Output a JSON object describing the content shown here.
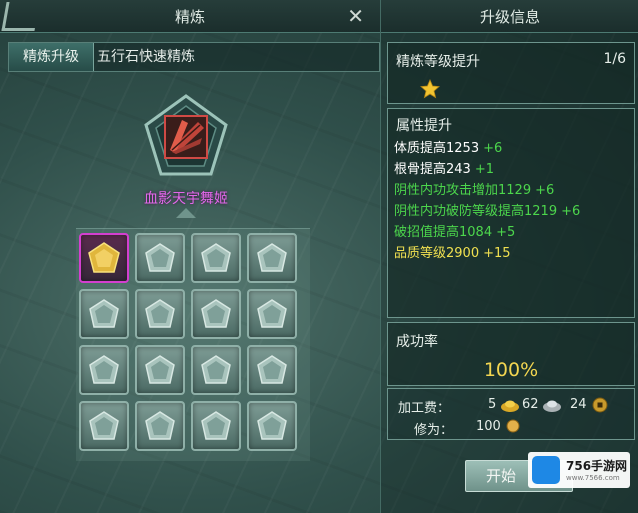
{
  "left_panel": {
    "title": "精炼",
    "tabs": [
      {
        "label": "精炼升级"
      },
      {
        "label": "五行石快速精炼"
      }
    ],
    "item_name": "血影天宇舞姬",
    "slots": 16
  },
  "right_panel": {
    "title": "升级信息",
    "level_up": {
      "label": "精炼等级提升",
      "count": "1/6"
    },
    "attributes": {
      "label": "属性提升",
      "rows": [
        {
          "text": "体质提高1253",
          "plus": "+6",
          "color": "#ffffff",
          "plus_color": "#4cd64c"
        },
        {
          "text": "根骨提高243",
          "plus": "+1",
          "color": "#ffffff",
          "plus_color": "#4cd64c"
        },
        {
          "text": "阴性内功攻击增加1129",
          "plus": "+6",
          "color": "#4cd64c",
          "plus_color": "#4cd64c"
        },
        {
          "text": "阴性内功破防等级提高1219",
          "plus": "+6",
          "color": "#4cd64c",
          "plus_color": "#4cd64c"
        },
        {
          "text": "破招值提高1084",
          "plus": "+5",
          "color": "#4cd64c",
          "plus_color": "#4cd64c"
        },
        {
          "text": "品质等级2900",
          "plus": "+15",
          "color": "#f0e050",
          "plus_color": "#f0e050"
        }
      ]
    },
    "success": {
      "label": "成功率",
      "value": "100%"
    },
    "cost": {
      "label": "加工费：",
      "gold": "5",
      "silver": "62",
      "copper": "24",
      "cultivation_label": "修为：",
      "cultivation": "100"
    },
    "start_button": "开始"
  },
  "watermark": {
    "name": "756手游网",
    "url": "www.7566.com"
  },
  "colors": {
    "accent_gold": "#f3d651",
    "highlight_magenta": "#e268ea",
    "green_stat": "#4cd64c"
  }
}
